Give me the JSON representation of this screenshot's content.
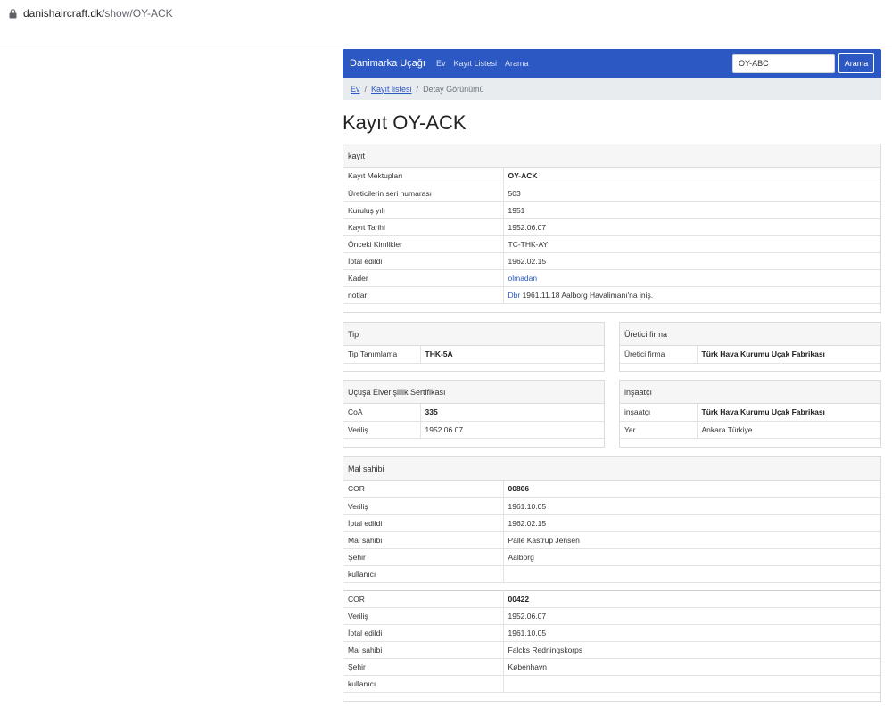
{
  "browser": {
    "url_domain": "danishaircraft.dk",
    "url_path": "/show/OY-ACK"
  },
  "nav": {
    "brand": "Danimarka Uçağı",
    "links": [
      "Ev",
      "Kayıt Listesi",
      "Arama"
    ],
    "search_value": "OY-ABC",
    "search_button": "Arama"
  },
  "breadcrumb": {
    "home": "Ev",
    "list": "Kayıt listesi",
    "current": "Detay Görünümü"
  },
  "title": "Kayıt OY-ACK",
  "registration": {
    "header": "kayıt",
    "rows": [
      {
        "k": "Kayıt Mektupları",
        "v": "OY-ACK"
      },
      {
        "k": "Üreticilerin seri numarası",
        "v": "503"
      },
      {
        "k": "Kuruluş yılı",
        "v": "1951"
      },
      {
        "k": "Kayıt Tarihi",
        "v": "1952.06.07"
      },
      {
        "k": "Önceki Kimlikler",
        "v": "TC-THK-AY"
      },
      {
        "k": "İptal edildi",
        "v": "1962.02.15"
      },
      {
        "k": "Kader",
        "v": "olmadan"
      },
      {
        "k": "notlar",
        "link": "Dbr",
        "v": "1961.11.18 Aalborg Havalimanı'na iniş."
      }
    ]
  },
  "type": {
    "header": "Tip",
    "rows": [
      {
        "k": "Tip Tanımlama",
        "v": "THK-5A"
      }
    ]
  },
  "manufacturer": {
    "header": "Üretici firma",
    "rows": [
      {
        "k": "Üretici firma",
        "v": "Türk Hava Kurumu Uçak Fabrikası"
      }
    ]
  },
  "coa": {
    "header": "Uçuşa Elverişlilik Sertifikası",
    "rows": [
      {
        "k": "CoA",
        "v": "335"
      },
      {
        "k": "Veriliş",
        "v": "1952.06.07"
      }
    ]
  },
  "builder": {
    "header": "inşaatçı",
    "rows": [
      {
        "k": "inşaatçı",
        "v": "Türk Hava Kurumu Uçak Fabrikası"
      },
      {
        "k": "Yer",
        "v": "Ankara Türkiye"
      }
    ]
  },
  "owner": {
    "header": "Mal sahibi",
    "blocks": [
      [
        {
          "k": "COR",
          "v": "00806"
        },
        {
          "k": "Veriliş",
          "v": "1961.10.05"
        },
        {
          "k": "İptal edildi",
          "v": "1962.02.15"
        },
        {
          "k": "Mal sahibi",
          "v": "Palle Kastrup Jensen"
        },
        {
          "k": "Şehir",
          "v": "Aalborg"
        },
        {
          "k": "kullanıcı",
          "v": ""
        }
      ],
      [
        {
          "k": "COR",
          "v": "00422"
        },
        {
          "k": "Veriliş",
          "v": "1952.06.07"
        },
        {
          "k": "İptal edildi",
          "v": "1961.10.05"
        },
        {
          "k": "Mal sahibi",
          "v": "Falcks Redningskorps"
        },
        {
          "k": "Şehir",
          "v": "København"
        },
        {
          "k": "kullanıcı",
          "v": ""
        }
      ]
    ]
  }
}
